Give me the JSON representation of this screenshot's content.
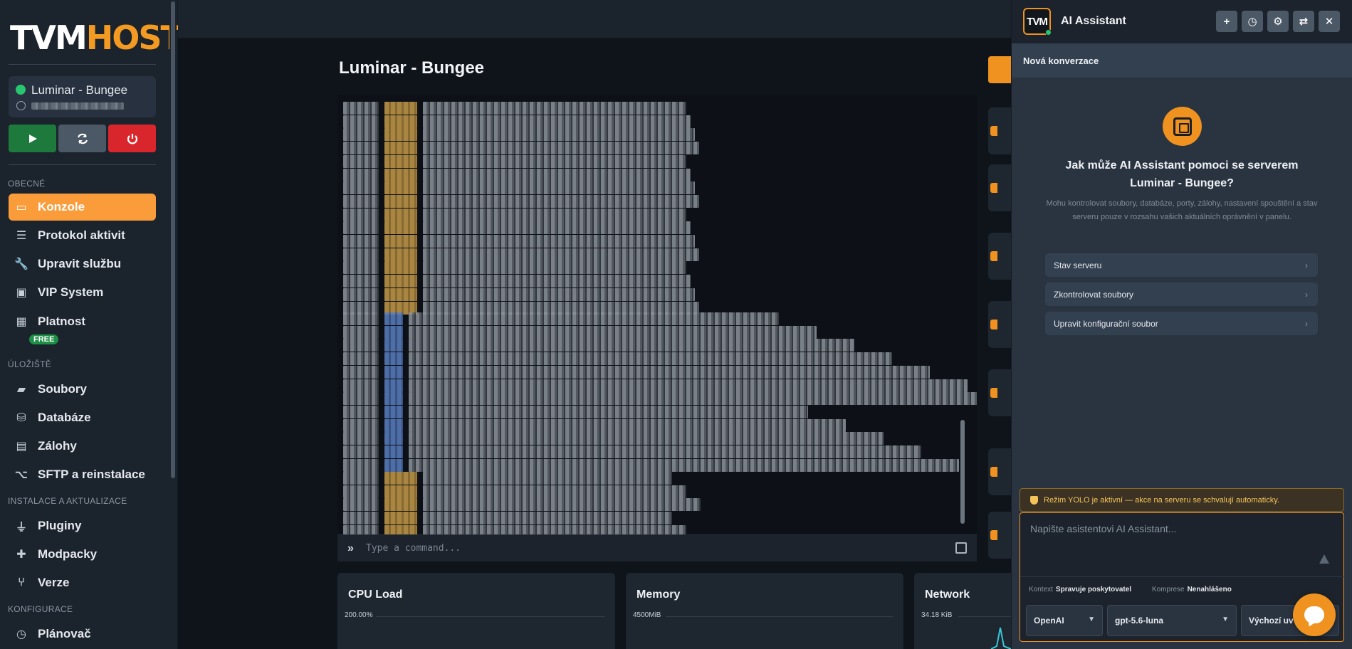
{
  "brand": {
    "logo_part1": "TVM",
    "logo_part2": "HOST"
  },
  "server": {
    "name": "Luminar - Bungee",
    "status_color": "#28c76f"
  },
  "controls": {
    "start_icon": "play-icon",
    "restart_icon": "refresh-icon",
    "stop_icon": "power-icon"
  },
  "sections": {
    "general": "OBECNÉ",
    "storage": "ÚLOŽIŠTĚ",
    "install": "INSTALACE A AKTUALIZACE",
    "config": "KONFIGURACE"
  },
  "nav": {
    "console": "Konzole",
    "activity": "Protokol aktivit",
    "edit_service": "Upravit službu",
    "vip": "VIP System",
    "validity": "Platnost",
    "validity_badge": "FREE",
    "files": "Soubory",
    "databases": "Databáze",
    "backups": "Zálohy",
    "sftp": "SFTP a reinstalace",
    "plugins": "Pluginy",
    "modpacks": "Modpacky",
    "versions": "Verze",
    "scheduler": "Plánovač"
  },
  "main": {
    "title": "Luminar - Bungee",
    "command_placeholder": "Type a command..."
  },
  "stats": {
    "cpu": {
      "title": "CPU Load",
      "max": "200.00%"
    },
    "memory": {
      "title": "Memory",
      "max": "4500MiB"
    },
    "network": {
      "title": "Network",
      "max": "34.18 KiB"
    }
  },
  "ai": {
    "title": "AI Assistant",
    "conversation": "Nová konverzace",
    "question": "Jak může AI Assistant pomoci se serverem Luminar - Bungee?",
    "description": "Mohu kontrolovat soubory, databáze, porty, zálohy, nastavení spouštění a stav serveru pouze v rozsahu vašich aktuálních oprávnění v panelu.",
    "suggestions": [
      "Stav serveru",
      "Zkontrolovat soubory",
      "Upravit konfigurační soubor"
    ],
    "yolo": "Režim YOLO je aktivní — akce na serveru se schvalují automaticky.",
    "input_placeholder": "Napište asistentovi AI Assistant...",
    "context_label": "Kontext",
    "context_value": "Spravuje poskytovatel",
    "compression_label": "Komprese",
    "compression_value": "Nenahlášeno",
    "provider": "OpenAI",
    "model": "gpt-5.6-luna",
    "default": "Výchozí uv"
  },
  "colors": {
    "accent": "#f0921f",
    "active_nav": "#fb9c3b",
    "danger": "#d9262c",
    "success": "#1e7a3c"
  }
}
